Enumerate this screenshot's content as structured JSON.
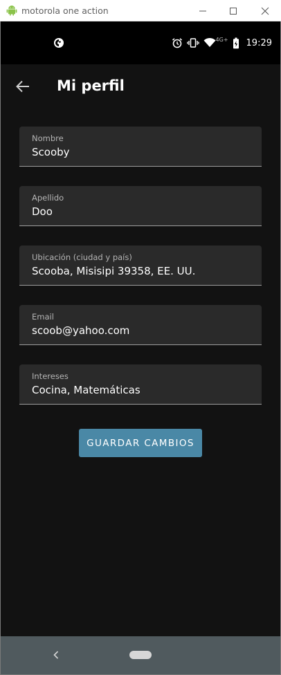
{
  "window": {
    "title": "motorola one action",
    "app_icon": "android-icon"
  },
  "statusbar": {
    "time": "19:29",
    "network_label": "4G+",
    "icons": [
      "app-notification-icon",
      "alarm-icon",
      "vibrate-icon",
      "wifi-icon",
      "battery-icon"
    ]
  },
  "appbar": {
    "title": "Mi perfil",
    "back_icon": "arrow-left-icon"
  },
  "form": {
    "fields": [
      {
        "label": "Nombre",
        "value": "Scooby"
      },
      {
        "label": "Apellido",
        "value": "Doo"
      },
      {
        "label": "Ubicación (ciudad y país)",
        "value": "Scooba, Misisipi 39358, EE. UU."
      },
      {
        "label": "Email",
        "value": "scoob@yahoo.com"
      },
      {
        "label": "Intereses",
        "value": "Cocina, Matemáticas"
      }
    ],
    "save_label": "GUARDAR CAMBIOS"
  },
  "colors": {
    "background": "#121212",
    "field_background": "#2a2a2a",
    "accent": "#4a88a6",
    "navbar": "#505a5e"
  }
}
